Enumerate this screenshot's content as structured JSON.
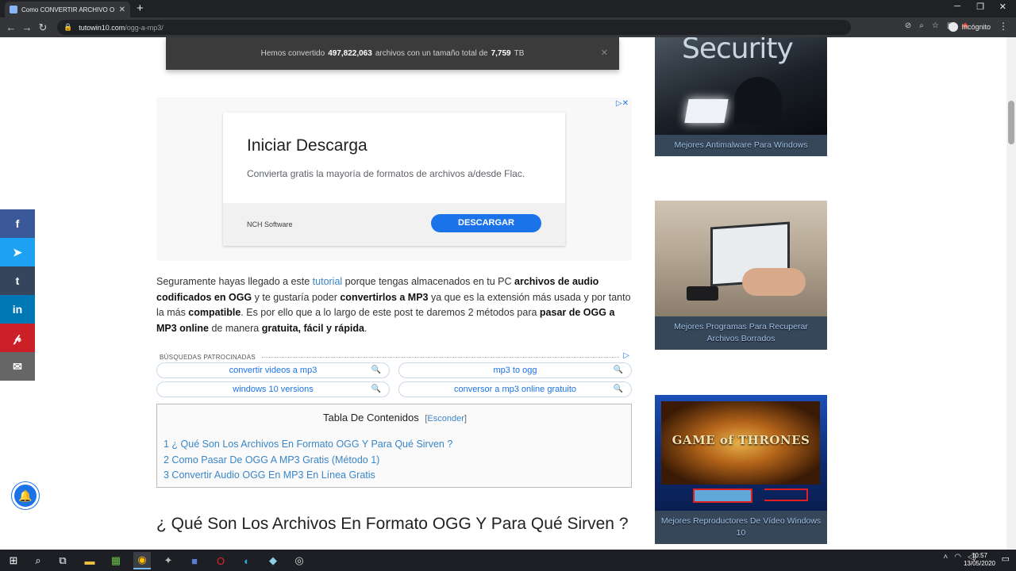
{
  "browser": {
    "tab_title": "Como CONVERTIR ARCHIVO O",
    "tab_close": "✕",
    "new_tab": "+",
    "url_domain": "tutowin10.com",
    "url_path": "/ogg-a-mp3/",
    "incognito_label": "Incógnito"
  },
  "banner": {
    "prefix": "Hemos convertido",
    "files": "497,822,063",
    "middle": "archivos con un tamaño total de",
    "size": "7,759",
    "unit": "TB"
  },
  "ad": {
    "title": "Iniciar Descarga",
    "subtitle": "Convierta gratis la mayoría de formatos de archivos a/desde Flac.",
    "advertiser": "NCH Software",
    "button": "DESCARGAR"
  },
  "intro": {
    "t1": "Seguramente hayas llegado a este ",
    "link": "tutorial",
    "t2": " porque tengas almacenados en tu PC ",
    "b1": "archivos de audio codificados en OGG",
    "t3": " y te gustaría poder ",
    "b2": "convertirlos a MP3",
    "t4": " ya que es la extensión más usada y por tanto la más ",
    "b3": "compatible",
    "t5": ". Es por ello que a lo largo de este post te daremos 2 métodos para ",
    "b4": "pasar de OGG a MP3 online",
    "t6": " de manera ",
    "b5": "gratuita, fácil y rápida",
    "t7": "."
  },
  "sponsored": {
    "label": "BÚSQUEDAS PATROCINADAS",
    "links": [
      "convertir videos a mp3",
      "mp3 to ogg",
      "windows 10 versions",
      "conversor a mp3 online gratuito"
    ]
  },
  "toc": {
    "title": "Tabla De Contenidos",
    "hide_open": "[",
    "hide_label": "Esconder",
    "hide_close": "]",
    "items": [
      "1 ¿ Qué Son Los Archivos En Formato OGG Y Para Qué Sirven ?",
      "2 Como Pasar De OGG A MP3 Gratis (Método 1)",
      "3 Convertir Audio OGG En MP3 En Línea Gratis"
    ]
  },
  "heading": "¿ Qué Son Los Archivos En Formato OGG Y Para Qué Sirven ?",
  "sidebar": {
    "security_word": "Security",
    "got_word": "GAME of THRONES",
    "cards": [
      "Mejores Antimalware Para Windows",
      "Mejores Programas Para Recuperar Archivos Borrados",
      "Mejores Reproductores De Vídeo Windows 10"
    ]
  },
  "social": {
    "facebook": "f",
    "twitter": "🐦",
    "tumblr": "t",
    "linkedin": "in",
    "pinterest": "℗",
    "email": "✉"
  },
  "taskbar": {
    "time": "10:57",
    "date": "13/05/2020"
  },
  "colors": {
    "brand_blue": "#1a73e8",
    "link_blue": "#3a86c8",
    "facebook": "#3b5998",
    "twitter": "#1da1f2",
    "tumblr": "#35465c",
    "linkedin": "#0077b5",
    "pinterest": "#cb2027",
    "email": "#666666"
  }
}
